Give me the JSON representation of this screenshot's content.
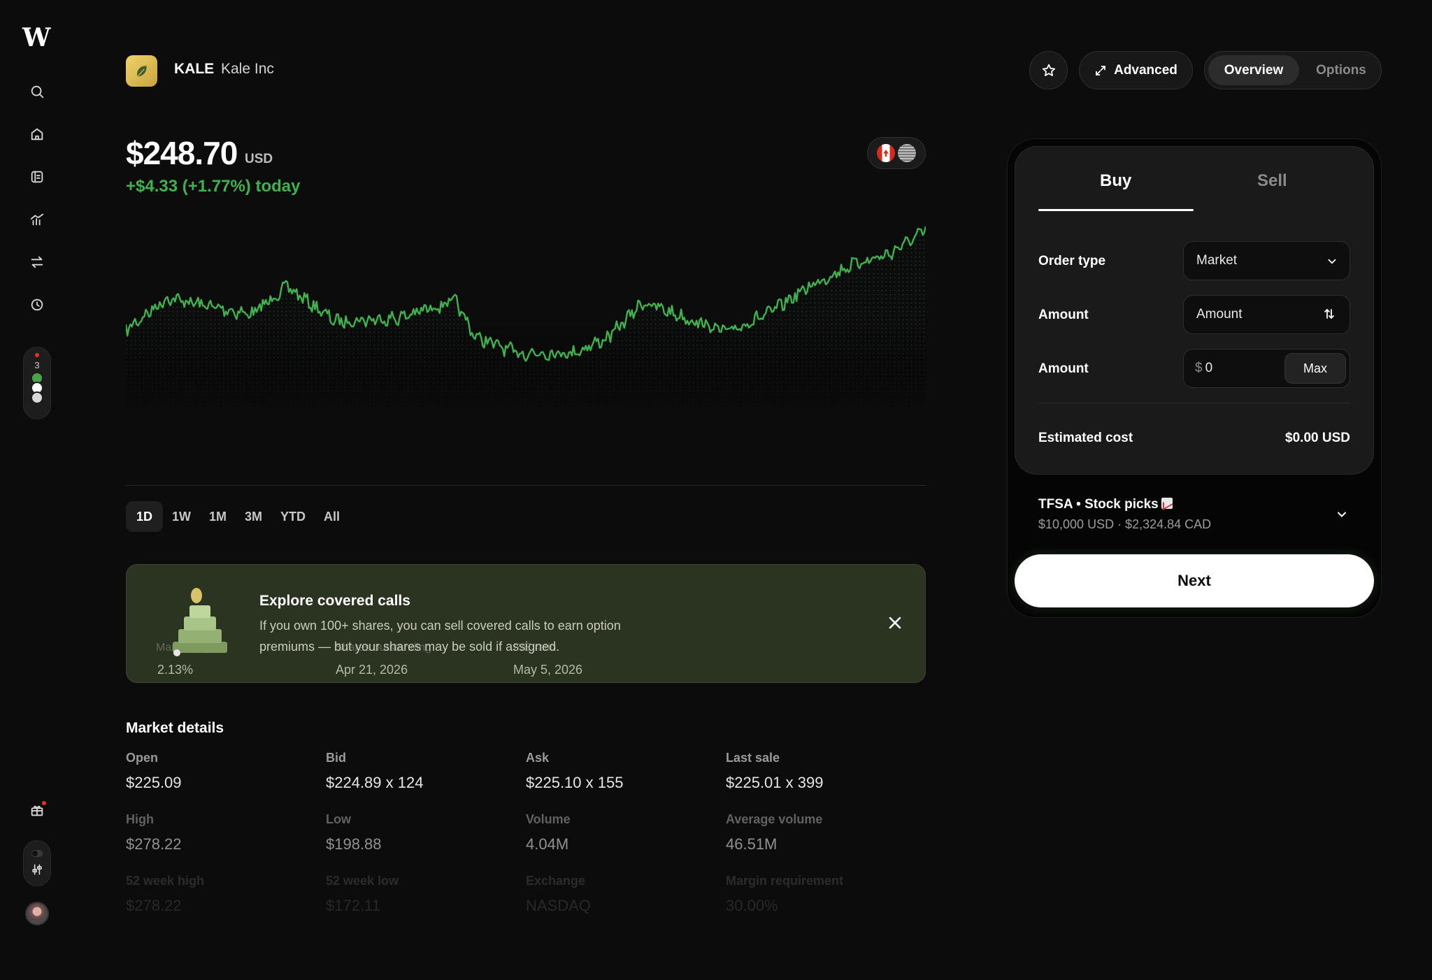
{
  "app": {
    "logo_text": "W"
  },
  "header": {
    "ticker": "KALE",
    "company": "Kale Inc",
    "advanced_label": "Advanced",
    "tabs": [
      {
        "label": "Overview",
        "active": true
      },
      {
        "label": "Options",
        "active": false
      }
    ]
  },
  "sidebar": {
    "items": [
      {
        "icon": "search-icon"
      },
      {
        "icon": "home-icon"
      },
      {
        "icon": "portfolio-icon"
      },
      {
        "icon": "chart-icon"
      },
      {
        "icon": "transfer-icon"
      },
      {
        "icon": "clock-icon"
      }
    ],
    "watchlist_count": "3"
  },
  "quote": {
    "price": "$248.70",
    "currency": "USD",
    "change": "+$4.33 (+1.77%) today"
  },
  "ranges": [
    "1D",
    "1W",
    "1M",
    "3M",
    "YTD",
    "All"
  ],
  "active_range": "1D",
  "banner": {
    "title": "Explore covered calls",
    "text": "If you own 100+ shares, you can sell covered calls to earn option premiums — but your shares may be sold if assigned.",
    "behind": [
      {
        "label": "Market cap",
        "value": "2.13%"
      },
      {
        "label": "Shares outstanding",
        "value": "Apr 21, 2026"
      },
      {
        "label": "P/E ratio",
        "value": "May 5, 2026"
      }
    ]
  },
  "market_details": {
    "title": "Market details",
    "rows": [
      [
        {
          "label": "Open",
          "value": "$225.09"
        },
        {
          "label": "Bid",
          "value": "$224.89 x 124"
        },
        {
          "label": "Ask",
          "value": "$225.10 x 155"
        },
        {
          "label": "Last sale",
          "value": "$225.01 x 399"
        }
      ],
      [
        {
          "label": "High",
          "value": "$278.22"
        },
        {
          "label": "Low",
          "value": "$198.88"
        },
        {
          "label": "Volume",
          "value": "4.04M"
        },
        {
          "label": "Average volume",
          "value": "46.51M"
        }
      ],
      [
        {
          "label": "52 week high",
          "value": "$278.22"
        },
        {
          "label": "52 week low",
          "value": "$172.11"
        },
        {
          "label": "Exchange",
          "value": "NASDAQ"
        },
        {
          "label": "Margin requirement",
          "value": "30.00%"
        }
      ]
    ]
  },
  "order": {
    "tabs": {
      "buy": "Buy",
      "sell": "Sell"
    },
    "order_type_label": "Order type",
    "order_type_value": "Market",
    "amount_label": "Amount",
    "amount_mode_value": "Amount",
    "amount_input_label": "Amount",
    "amount_currency_symbol": "$",
    "amount_value": "0",
    "max_label": "Max",
    "estimated_cost_label": "Estimated cost",
    "estimated_cost_value": "$0.00 USD",
    "account_title": "TFSA • Stock picks",
    "account_sub": "$10,000 USD · $2,324.84 CAD",
    "next_label": "Next"
  },
  "colors": {
    "positive": "#3fb24f",
    "banner_bg": "#2b3321",
    "background": "#0c0c0c"
  }
}
